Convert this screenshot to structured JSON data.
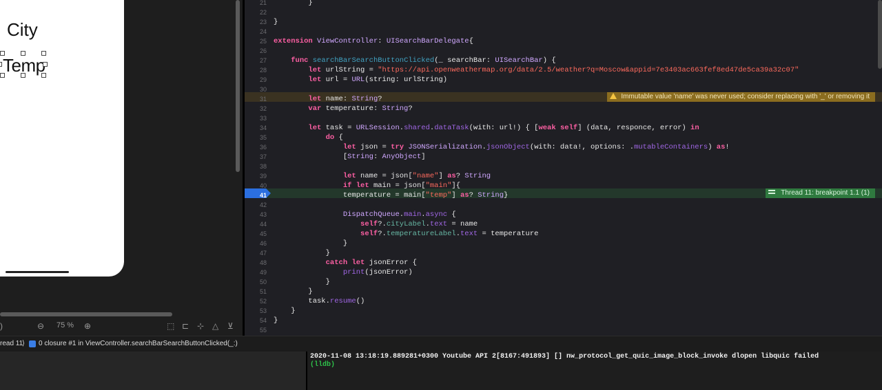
{
  "canvas": {
    "labels": {
      "city": "City",
      "temp": "Temp"
    },
    "zoom_level": "75 %"
  },
  "editor": {
    "lines": [
      {
        "no": "21",
        "tokens": [
          {
            "t": "        }",
            "c": "plain"
          }
        ]
      },
      {
        "no": "22",
        "tokens": []
      },
      {
        "no": "23",
        "tokens": [
          {
            "t": "}",
            "c": "plain"
          }
        ]
      },
      {
        "no": "24",
        "tokens": []
      },
      {
        "no": "25",
        "tokens": [
          {
            "t": "extension",
            "c": "kw"
          },
          {
            "t": " ",
            "c": "plain"
          },
          {
            "t": "ViewController",
            "c": "ty"
          },
          {
            "t": ": ",
            "c": "plain"
          },
          {
            "t": "UISearchBarDelegate",
            "c": "ty"
          },
          {
            "t": "{",
            "c": "plain"
          }
        ]
      },
      {
        "no": "26",
        "tokens": []
      },
      {
        "no": "27",
        "tokens": [
          {
            "t": "    ",
            "c": "plain"
          },
          {
            "t": "func",
            "c": "kw"
          },
          {
            "t": " ",
            "c": "plain"
          },
          {
            "t": "searchBarSearchButtonClicked",
            "c": "fnname"
          },
          {
            "t": "(_ searchBar: ",
            "c": "plain"
          },
          {
            "t": "UISearchBar",
            "c": "ty"
          },
          {
            "t": ") {",
            "c": "plain"
          }
        ]
      },
      {
        "no": "28",
        "tokens": [
          {
            "t": "        ",
            "c": "plain"
          },
          {
            "t": "let",
            "c": "kw"
          },
          {
            "t": " urlString = ",
            "c": "plain"
          },
          {
            "t": "\"https://api.openweathermap.org/data/2.5/weather?q=Moscow&appid=7e3403ac663fef8ed47de5ca39a32c07\"",
            "c": "str"
          }
        ]
      },
      {
        "no": "29",
        "tokens": [
          {
            "t": "        ",
            "c": "plain"
          },
          {
            "t": "let",
            "c": "kw"
          },
          {
            "t": " url = ",
            "c": "plain"
          },
          {
            "t": "URL",
            "c": "ty"
          },
          {
            "t": "(string: urlString)",
            "c": "plain"
          }
        ]
      },
      {
        "no": "30",
        "tokens": []
      },
      {
        "no": "31",
        "tokens": [
          {
            "t": "        ",
            "c": "plain"
          },
          {
            "t": "let",
            "c": "kw"
          },
          {
            "t": " name: ",
            "c": "plain"
          },
          {
            "t": "String",
            "c": "ty"
          },
          {
            "t": "?",
            "c": "plain"
          }
        ]
      },
      {
        "no": "32",
        "tokens": [
          {
            "t": "        ",
            "c": "plain"
          },
          {
            "t": "var",
            "c": "kw"
          },
          {
            "t": " temperature: ",
            "c": "plain"
          },
          {
            "t": "String",
            "c": "ty"
          },
          {
            "t": "?",
            "c": "plain"
          }
        ]
      },
      {
        "no": "33",
        "tokens": []
      },
      {
        "no": "34",
        "tokens": [
          {
            "t": "        ",
            "c": "plain"
          },
          {
            "t": "let",
            "c": "kw"
          },
          {
            "t": " task = ",
            "c": "plain"
          },
          {
            "t": "URLSession",
            "c": "ty"
          },
          {
            "t": ".",
            "c": "plain"
          },
          {
            "t": "shared",
            "c": "prop"
          },
          {
            "t": ".",
            "c": "plain"
          },
          {
            "t": "dataTask",
            "c": "prop"
          },
          {
            "t": "(with: url!) { [",
            "c": "plain"
          },
          {
            "t": "weak",
            "c": "kw"
          },
          {
            "t": " ",
            "c": "plain"
          },
          {
            "t": "self",
            "c": "kw"
          },
          {
            "t": "] (data, responce, error) ",
            "c": "plain"
          },
          {
            "t": "in",
            "c": "kw"
          }
        ]
      },
      {
        "no": "35",
        "tokens": [
          {
            "t": "            ",
            "c": "plain"
          },
          {
            "t": "do",
            "c": "kw"
          },
          {
            "t": " {",
            "c": "plain"
          }
        ]
      },
      {
        "no": "36",
        "tokens": [
          {
            "t": "                ",
            "c": "plain"
          },
          {
            "t": "let",
            "c": "kw"
          },
          {
            "t": " json = ",
            "c": "plain"
          },
          {
            "t": "try",
            "c": "kw"
          },
          {
            "t": " ",
            "c": "plain"
          },
          {
            "t": "JSONSerialization",
            "c": "ty"
          },
          {
            "t": ".",
            "c": "plain"
          },
          {
            "t": "jsonObject",
            "c": "prop"
          },
          {
            "t": "(with: data!, options: .",
            "c": "plain"
          },
          {
            "t": "mutableContainers",
            "c": "prop"
          },
          {
            "t": ") ",
            "c": "plain"
          },
          {
            "t": "as",
            "c": "kw"
          },
          {
            "t": "!",
            "c": "plain"
          }
        ]
      },
      {
        "no": "37",
        "tokens": [
          {
            "t": "                [",
            "c": "plain"
          },
          {
            "t": "String",
            "c": "ty"
          },
          {
            "t": ": ",
            "c": "plain"
          },
          {
            "t": "AnyObject",
            "c": "ty"
          },
          {
            "t": "]",
            "c": "plain"
          }
        ]
      },
      {
        "no": "38",
        "tokens": []
      },
      {
        "no": "39",
        "tokens": [
          {
            "t": "                ",
            "c": "plain"
          },
          {
            "t": "let",
            "c": "kw"
          },
          {
            "t": " name = json[",
            "c": "plain"
          },
          {
            "t": "\"name\"",
            "c": "str"
          },
          {
            "t": "] ",
            "c": "plain"
          },
          {
            "t": "as",
            "c": "kw"
          },
          {
            "t": "? ",
            "c": "plain"
          },
          {
            "t": "String",
            "c": "ty"
          }
        ]
      },
      {
        "no": "40",
        "tokens": [
          {
            "t": "                ",
            "c": "plain"
          },
          {
            "t": "if",
            "c": "kw"
          },
          {
            "t": " ",
            "c": "plain"
          },
          {
            "t": "let",
            "c": "kw"
          },
          {
            "t": " main = json[",
            "c": "plain"
          },
          {
            "t": "\"main\"",
            "c": "str"
          },
          {
            "t": "]{",
            "c": "plain"
          }
        ]
      },
      {
        "no": "41",
        "tokens": [
          {
            "t": "                temperature = main[",
            "c": "plain"
          },
          {
            "t": "\"temp\"",
            "c": "str"
          },
          {
            "t": "] ",
            "c": "plain"
          },
          {
            "t": "as",
            "c": "kw"
          },
          {
            "t": "? ",
            "c": "plain"
          },
          {
            "t": "String",
            "c": "ty"
          },
          {
            "t": "}",
            "c": "plain"
          }
        ]
      },
      {
        "no": "42",
        "tokens": []
      },
      {
        "no": "43",
        "tokens": [
          {
            "t": "                ",
            "c": "plain"
          },
          {
            "t": "DispatchQueue",
            "c": "ty"
          },
          {
            "t": ".",
            "c": "plain"
          },
          {
            "t": "main",
            "c": "prop"
          },
          {
            "t": ".",
            "c": "plain"
          },
          {
            "t": "async",
            "c": "prop"
          },
          {
            "t": " {",
            "c": "plain"
          }
        ]
      },
      {
        "no": "44",
        "tokens": [
          {
            "t": "                    ",
            "c": "plain"
          },
          {
            "t": "self",
            "c": "kw"
          },
          {
            "t": "?.",
            "c": "plain"
          },
          {
            "t": "cityLabel",
            "c": "fn"
          },
          {
            "t": ".",
            "c": "plain"
          },
          {
            "t": "text",
            "c": "prop"
          },
          {
            "t": " = name",
            "c": "plain"
          }
        ]
      },
      {
        "no": "45",
        "tokens": [
          {
            "t": "                    ",
            "c": "plain"
          },
          {
            "t": "self",
            "c": "kw"
          },
          {
            "t": "?.",
            "c": "plain"
          },
          {
            "t": "temperatureLabel",
            "c": "fn"
          },
          {
            "t": ".",
            "c": "plain"
          },
          {
            "t": "text",
            "c": "prop"
          },
          {
            "t": " = temperature",
            "c": "plain"
          }
        ]
      },
      {
        "no": "46",
        "tokens": [
          {
            "t": "                }",
            "c": "plain"
          }
        ]
      },
      {
        "no": "47",
        "tokens": [
          {
            "t": "            }",
            "c": "plain"
          }
        ]
      },
      {
        "no": "48",
        "tokens": [
          {
            "t": "            ",
            "c": "plain"
          },
          {
            "t": "catch",
            "c": "kw"
          },
          {
            "t": " ",
            "c": "plain"
          },
          {
            "t": "let",
            "c": "kw"
          },
          {
            "t": " jsonError {",
            "c": "plain"
          }
        ]
      },
      {
        "no": "49",
        "tokens": [
          {
            "t": "                ",
            "c": "plain"
          },
          {
            "t": "print",
            "c": "prop"
          },
          {
            "t": "(jsonError)",
            "c": "plain"
          }
        ]
      },
      {
        "no": "50",
        "tokens": [
          {
            "t": "            }",
            "c": "plain"
          }
        ]
      },
      {
        "no": "51",
        "tokens": [
          {
            "t": "        }",
            "c": "plain"
          }
        ]
      },
      {
        "no": "52",
        "tokens": [
          {
            "t": "        task.",
            "c": "plain"
          },
          {
            "t": "resume",
            "c": "prop"
          },
          {
            "t": "()",
            "c": "plain"
          }
        ]
      },
      {
        "no": "53",
        "tokens": [
          {
            "t": "    }",
            "c": "plain"
          }
        ]
      },
      {
        "no": "54",
        "tokens": [
          {
            "t": "}",
            "c": "plain"
          }
        ]
      },
      {
        "no": "55",
        "tokens": []
      }
    ],
    "warning": "Immutable value 'name' was never used; consider replacing with '_' or removing it",
    "breakpoint": "Thread 11: breakpoint 1.1 (1)"
  },
  "debug_bar": {
    "thread": "read 11",
    "frame": "0 closure #1 in ViewController.searchBarSearchButtonClicked(_:)"
  },
  "console": {
    "log": "2020-11-08 13:18:19.889281+0300 Youtube API 2[8167:491893] [] nw_protocol_get_quic_image_block_invoke dlopen libquic failed",
    "prompt": "(lldb)"
  }
}
